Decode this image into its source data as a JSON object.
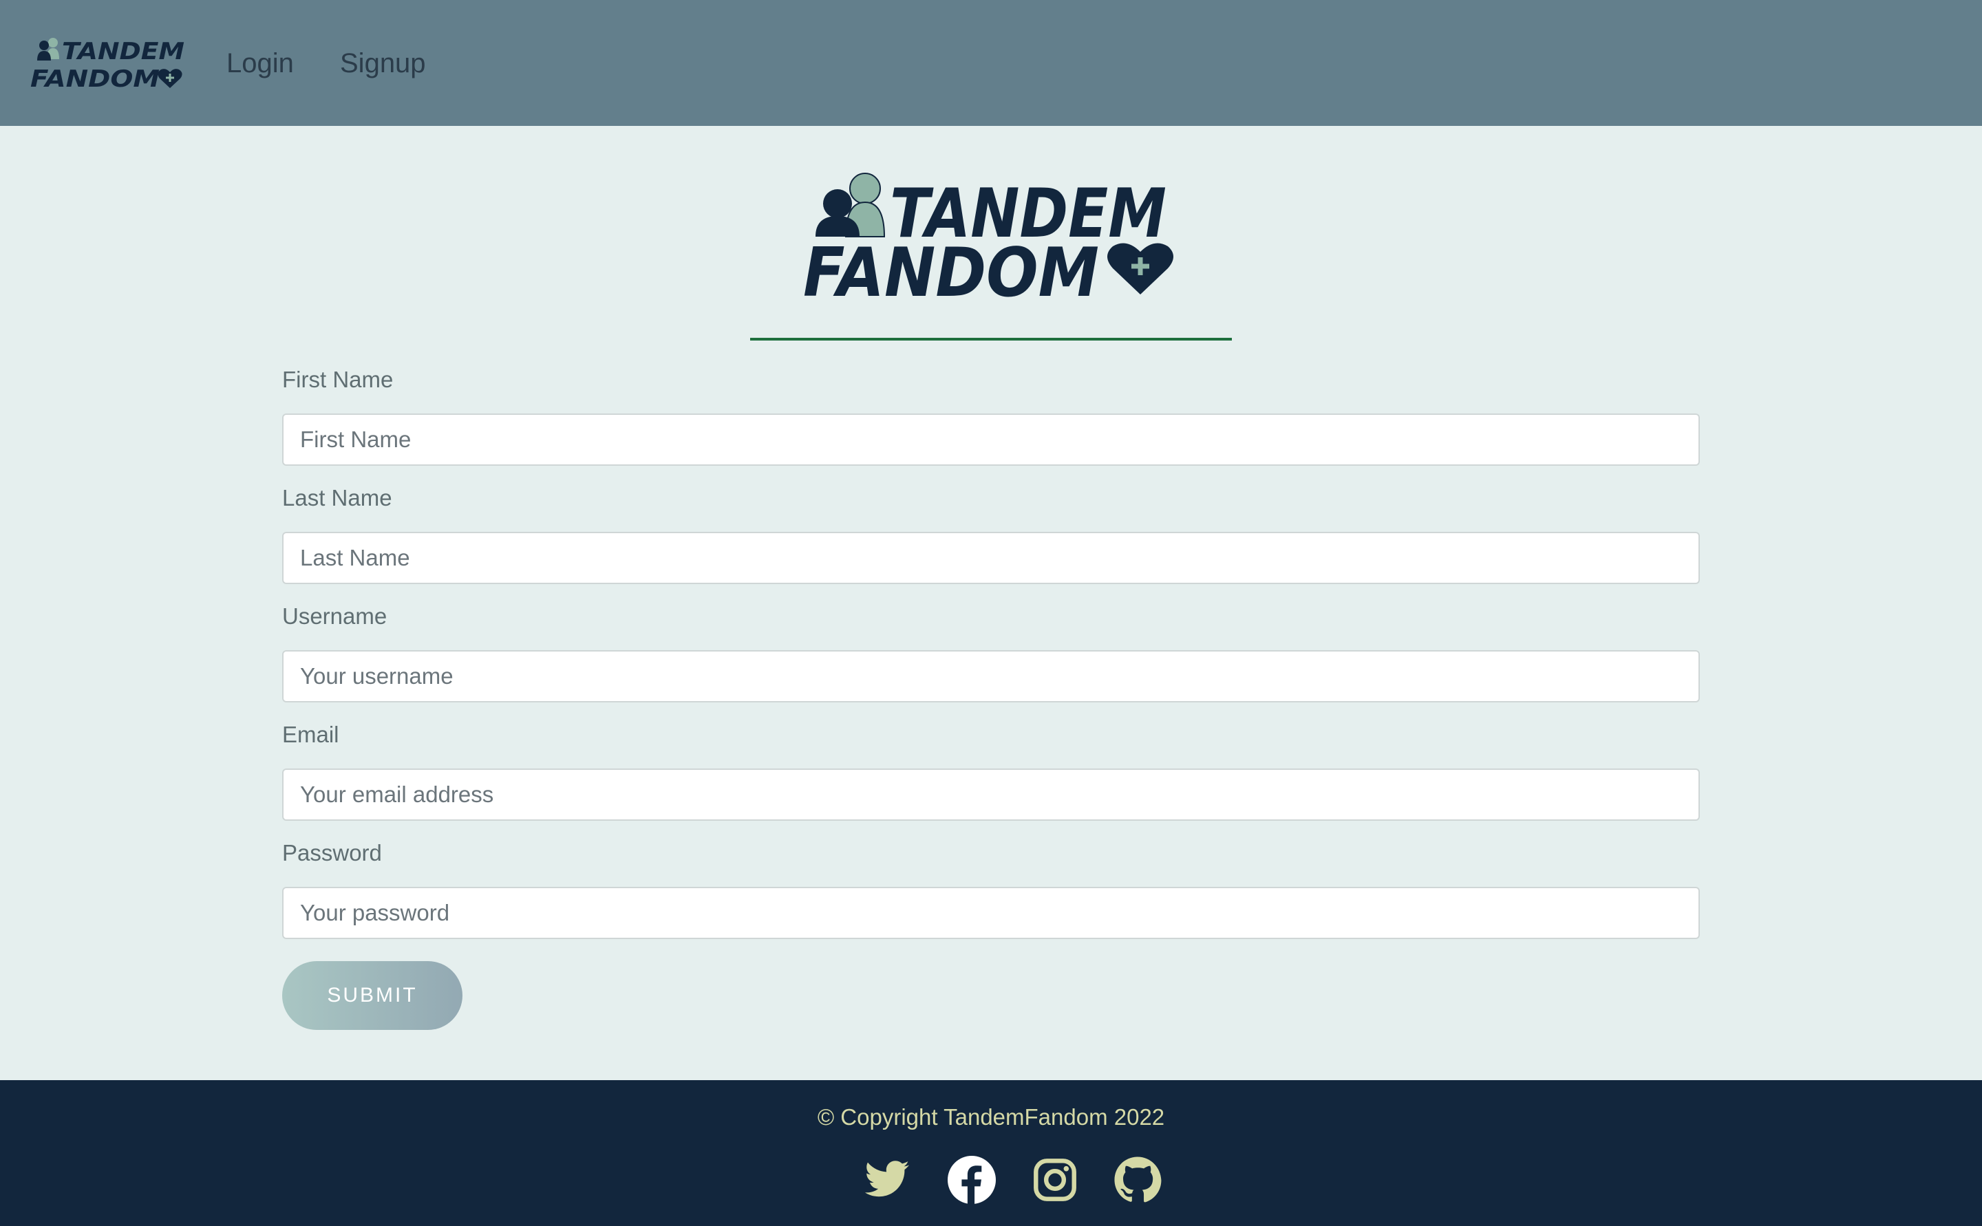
{
  "nav": {
    "logo_alt": "TandemFandom",
    "login_label": "Login",
    "signup_label": "Signup"
  },
  "logo": {
    "line1": "TANDEM",
    "line2": "FANDOM"
  },
  "form": {
    "fields": [
      {
        "label": "First Name",
        "placeholder": "First Name",
        "value": ""
      },
      {
        "label": "Last Name",
        "placeholder": "Last Name",
        "value": ""
      },
      {
        "label": "Username",
        "placeholder": "Your username",
        "value": ""
      },
      {
        "label": "Email",
        "placeholder": "Your email address",
        "value": ""
      },
      {
        "label": "Password",
        "placeholder": "Your password",
        "value": ""
      }
    ],
    "submit_label": "SUBMIT"
  },
  "footer": {
    "copyright": "© Copyright TandemFandom 2022",
    "social": [
      {
        "icon": "twitter-icon"
      },
      {
        "icon": "facebook-icon"
      },
      {
        "icon": "instagram-icon"
      },
      {
        "icon": "github-icon"
      }
    ]
  },
  "colors": {
    "navbar_bg": "#637f8c",
    "page_bg": "#e5efee",
    "footer_bg": "#12263d",
    "brand_navy": "#12263d",
    "brand_sage": "#8fb4a6",
    "divider": "#1e6f3d",
    "footer_text": "#d5d9a6"
  }
}
